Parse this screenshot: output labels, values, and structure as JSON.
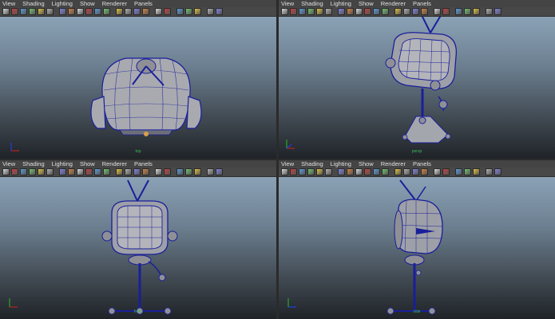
{
  "menu": [
    "View",
    "Shading",
    "Lighting",
    "Show",
    "Renderer",
    "Panels"
  ],
  "toolbar_icons": [
    "select-camera-icon",
    "lock-camera-icon",
    "bookmark-icon",
    "grid-icon",
    "image-plane-icon",
    "2d-pan-icon",
    "sep",
    "film-gate-icon",
    "resolution-gate-icon",
    "gate-mask-icon",
    "field-chart-icon",
    "safe-action-icon",
    "safe-title-icon",
    "sep",
    "wireframe-icon",
    "smooth-shade-icon",
    "wireframe-on-shaded-icon",
    "textured-icon",
    "sep",
    "use-all-lights-icon",
    "shadows-icon",
    "sep",
    "isolate-icon",
    "xray-icon",
    "xray-joints-icon",
    "sep",
    "camera-attributes-icon",
    "frame-all-icon"
  ],
  "panels": [
    {
      "id": "top",
      "camera": "top"
    },
    {
      "id": "persp",
      "camera": "persp"
    },
    {
      "id": "front",
      "camera": "front"
    },
    {
      "id": "side",
      "camera": "side"
    }
  ],
  "axis_labels": {
    "x": "x",
    "y": "y",
    "z": "z"
  },
  "colors": {
    "wireframe": "#1a1f9a",
    "mesh_fill": "#a9aab0",
    "camera_label": "#3dbb55",
    "axis_x": "#d02020",
    "axis_y": "#20c020",
    "axis_z": "#2040ff"
  }
}
